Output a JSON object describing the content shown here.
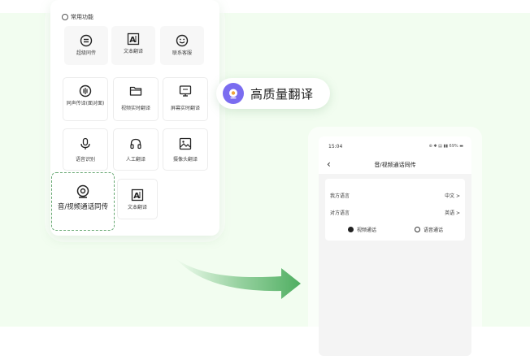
{
  "colors": {
    "background": "#f2fdf0",
    "accent_green": "#5cb56c",
    "dashed_border": "#6aaa75",
    "pill_icon": "#7a6cf0"
  },
  "left_panel": {
    "section_title": "常用功能",
    "row1": [
      {
        "label": "超级同传",
        "icon": "equals-circle-icon"
      },
      {
        "label": "文本翻译",
        "icon": "text-translate-icon"
      },
      {
        "label": "联系客服",
        "icon": "smile-chat-icon"
      }
    ],
    "row2": [
      {
        "label": "同声传译(面对面)",
        "icon": "simultaneous-interp-icon"
      },
      {
        "label": "视频实时翻译",
        "icon": "folder-icon"
      },
      {
        "label": "屏幕实时翻译",
        "icon": "screen-icon"
      }
    ],
    "row3": [
      {
        "label": "语音识别",
        "icon": "microphone-icon"
      },
      {
        "label": "人工翻译",
        "icon": "headset-icon"
      },
      {
        "label": "摄像头翻译",
        "icon": "image-icon"
      }
    ],
    "row4": [
      {
        "label": "音/视频通话同传",
        "icon": "webcam-icon"
      },
      {
        "label": "文本翻译",
        "icon": "text-translate-icon"
      }
    ]
  },
  "pill": {
    "label": "高质量翻译",
    "icon": "webcam-icon"
  },
  "phone": {
    "status_time": "15:04",
    "status_right": "69%",
    "title": "音/视频通话同传",
    "rows": [
      {
        "label": "我方语言",
        "value": "中文 >"
      },
      {
        "label": "对方语言",
        "value": "英语 >"
      }
    ],
    "options": [
      {
        "label": "视频通话",
        "selected": true
      },
      {
        "label": "语音通话",
        "selected": false
      }
    ]
  }
}
